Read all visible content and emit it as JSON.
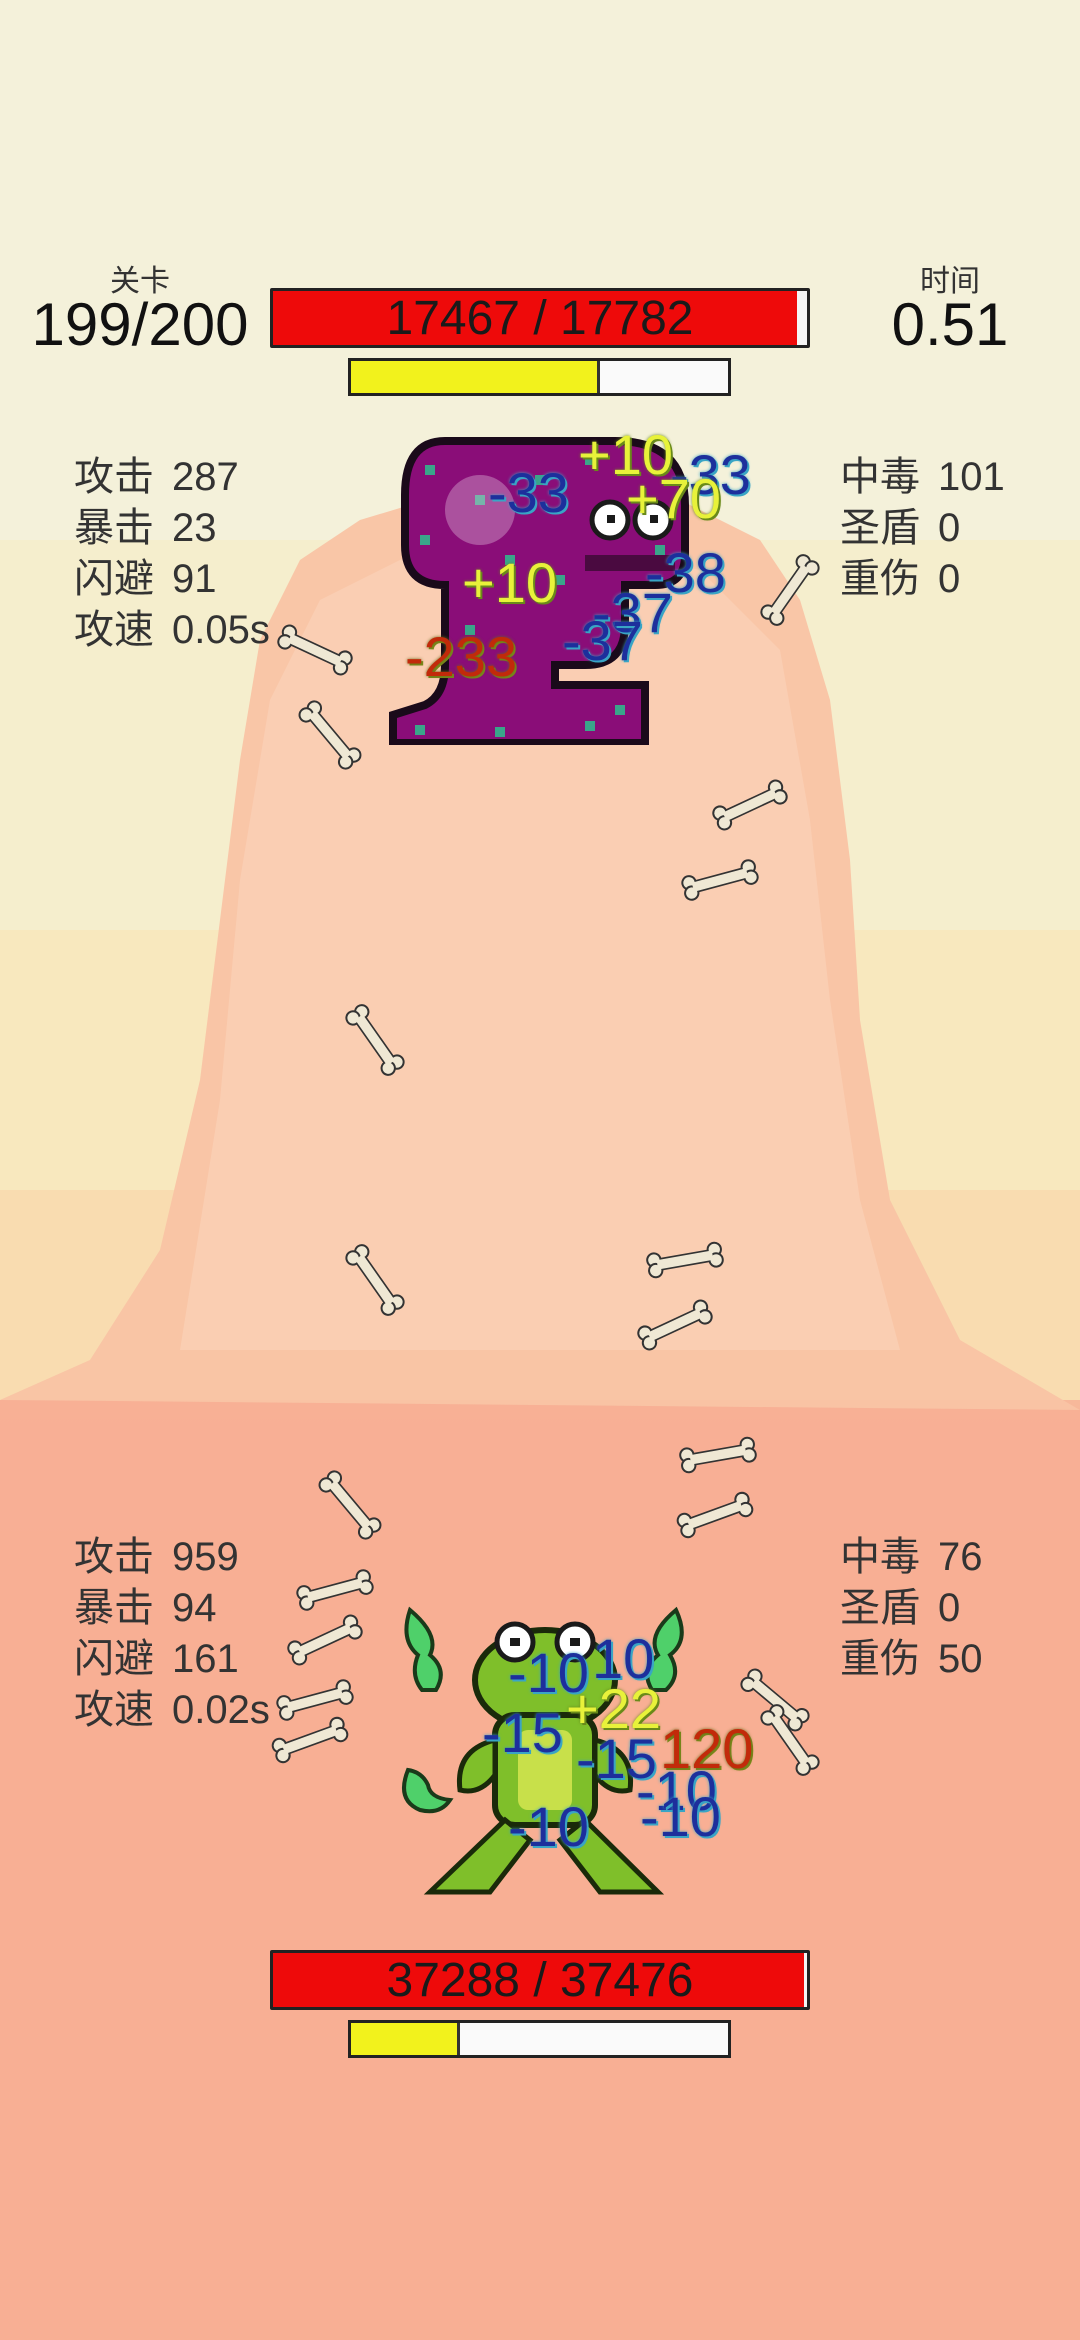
{
  "top_hud": {
    "level_label": "关卡",
    "level_value": "199/200",
    "time_label": "时间",
    "time_value": "0.51"
  },
  "enemy": {
    "hp_text": "17467 / 17782",
    "hp_fraction": 0.982,
    "energy_fraction": 0.66,
    "stats_left": [
      {
        "label": "攻击",
        "value": "287"
      },
      {
        "label": "暴击",
        "value": "23"
      },
      {
        "label": "闪避",
        "value": "91"
      },
      {
        "label": "攻速",
        "value": "0.05s"
      }
    ],
    "stats_right": [
      {
        "label": "中毒",
        "value": "101"
      },
      {
        "label": "圣盾",
        "value": "0"
      },
      {
        "label": "重伤",
        "value": "0"
      }
    ]
  },
  "player": {
    "hp_text": "37288 / 37476",
    "hp_fraction": 0.995,
    "energy_fraction": 0.29,
    "stats_left": [
      {
        "label": "攻击",
        "value": "959"
      },
      {
        "label": "暴击",
        "value": "94"
      },
      {
        "label": "闪避",
        "value": "161"
      },
      {
        "label": "攻速",
        "value": "0.02s"
      }
    ],
    "stats_right": [
      {
        "label": "中毒",
        "value": "76"
      },
      {
        "label": "圣盾",
        "value": "0"
      },
      {
        "label": "重伤",
        "value": "50"
      }
    ]
  },
  "floating_numbers_enemy": [
    "+10",
    "-33",
    "-33",
    "+70",
    "+10",
    "-38",
    "-37",
    "-37",
    "-233"
  ],
  "floating_numbers_player": [
    "-10",
    "10",
    "+22",
    "-15",
    "-15",
    "120",
    "-10",
    "-10",
    "-10"
  ],
  "colors": {
    "hp_fill": "#ee0a0a",
    "energy_fill": "#f2f21c",
    "damage_blue": "#1d2f9c",
    "heal_yellow": "#e8f23a",
    "crit_red": "#c22a0a",
    "enemy_purple": "#8a0d78",
    "player_green": "#7fbf2a"
  }
}
